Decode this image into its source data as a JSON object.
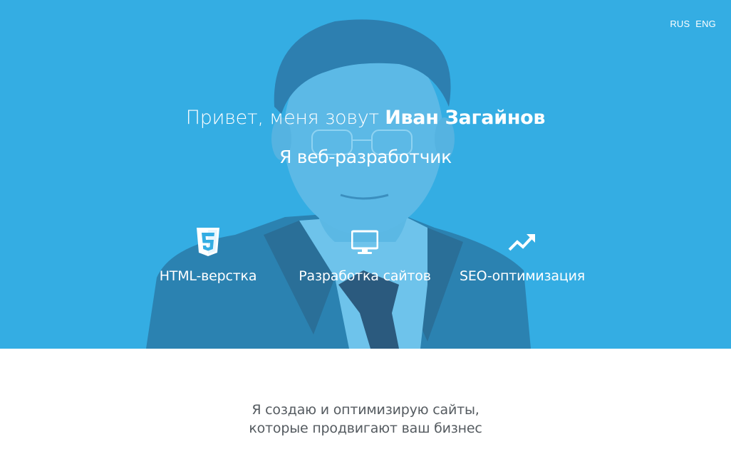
{
  "lang": {
    "rus": "RUS",
    "eng": "ENG"
  },
  "hero": {
    "greeting_prefix": "Привет, меня зовут ",
    "greeting_name": "Иван Загайнов",
    "subtitle": "Я веб-разработчик",
    "background_color": "#34ade3"
  },
  "services": [
    {
      "icon": "html5-icon",
      "label": "HTML-верстка"
    },
    {
      "icon": "monitor-icon",
      "label": "Разработка сайтов"
    },
    {
      "icon": "trending-up-icon",
      "label": "SEO-оптимизация"
    }
  ],
  "about": {
    "line1": "Я создаю и оптимизирую сайты,",
    "line2": "которые продвигают ваш бизнес"
  }
}
